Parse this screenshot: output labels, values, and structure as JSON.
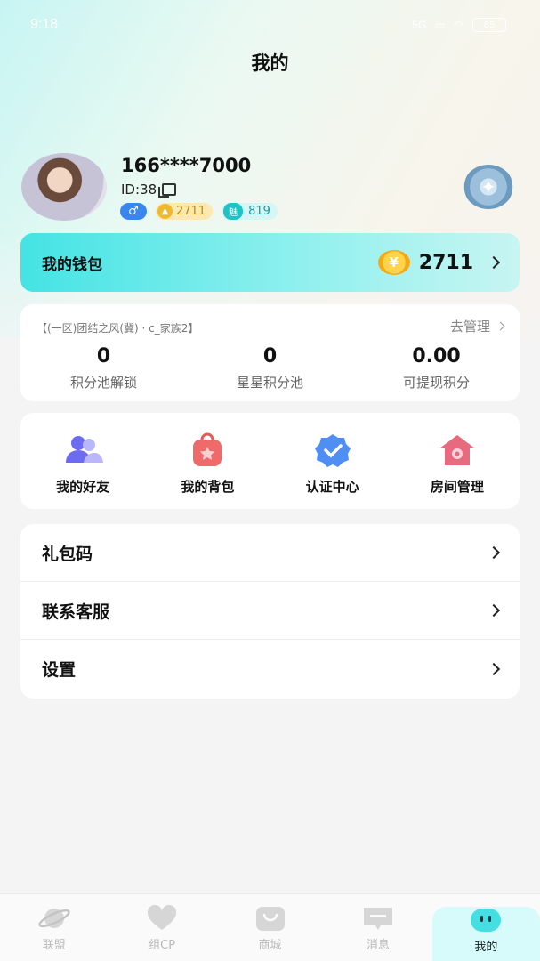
{
  "status_bar": {
    "time": "9:18",
    "signal_text": "5G",
    "battery": "85"
  },
  "page_title": "我的",
  "profile": {
    "username": "166****7000",
    "id_text": "ID:38",
    "gender_symbol": "♂",
    "coin_balance": "2711",
    "charm_icon_text": "魅",
    "charm_value": "819"
  },
  "wallet": {
    "label": "我的钱包",
    "coin_symbol": "¥",
    "amount": "2711"
  },
  "stats": {
    "family_text": "【(一区)团结之风(冀) · c_家族2】",
    "manage_label": "去管理",
    "items": [
      {
        "value": "0",
        "label": "积分池解锁"
      },
      {
        "value": "0",
        "label": "星星积分池"
      },
      {
        "value": "0.00",
        "label": "可提现积分"
      }
    ]
  },
  "quick_actions": [
    {
      "label": "我的好友",
      "icon": "friends-icon"
    },
    {
      "label": "我的背包",
      "icon": "backpack-icon"
    },
    {
      "label": "认证中心",
      "icon": "verify-icon"
    },
    {
      "label": "房间管理",
      "icon": "room-icon"
    }
  ],
  "menu": [
    {
      "label": "礼包码"
    },
    {
      "label": "联系客服"
    },
    {
      "label": "设置"
    }
  ],
  "tabs": [
    {
      "label": "联盟",
      "icon": "planet-icon"
    },
    {
      "label": "组CP",
      "icon": "heart-icon"
    },
    {
      "label": "商城",
      "icon": "shop-bag-icon"
    },
    {
      "label": "消息",
      "icon": "message-icon"
    },
    {
      "label": "我的",
      "icon": "face-icon",
      "active": true
    }
  ],
  "colors": {
    "accent": "#3fe0e0",
    "coin": "#f5b31c",
    "gender": "#3a86f0",
    "charm": "#1fc3c7"
  }
}
